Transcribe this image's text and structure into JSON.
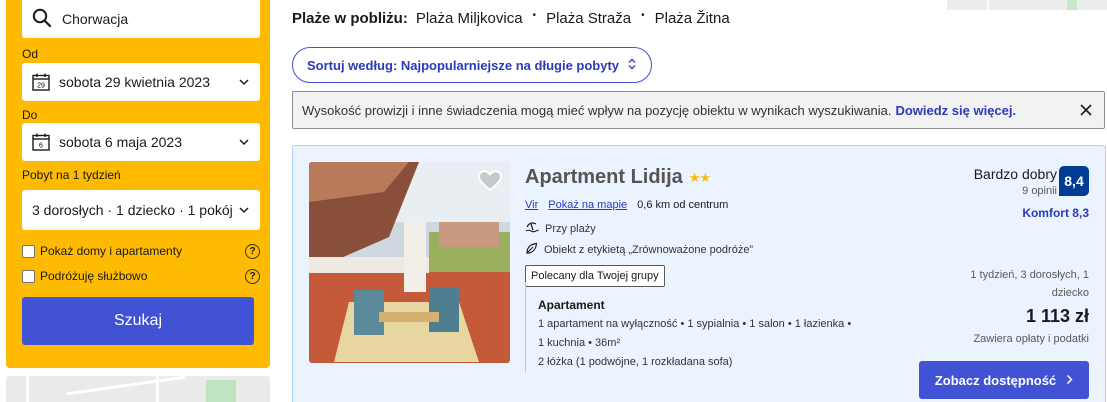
{
  "sidebar": {
    "destination": "Chorwacja",
    "checkin_label": "Od",
    "checkin_value": "sobota 29 kwietnia 2023",
    "checkin_day": "29",
    "checkout_label": "Do",
    "checkout_value": "sobota 6 maja 2023",
    "checkout_day": "6",
    "stay_label": "Pobyt na 1 tydzień",
    "guests_value": "3 dorosłych · 1 dziecko · 1 pokój",
    "checkbox_homes": "Pokaż domy i apartamenty",
    "checkbox_business": "Podróżuję służbowo",
    "search_button": "Szukaj"
  },
  "main": {
    "beaches_label": "Plaże w pobliżu:",
    "beaches": [
      "Plaża Miljkovica",
      "Plaża Straža",
      "Plaża Žitna"
    ],
    "sort_button": "Sortuj według: Najpopularniejsze na długie pobyty",
    "notice_text": "Wysokość prowizji i inne świadczenia mogą mieć wpływ na pozycję obiektu w wynikach wyszukiwania.",
    "notice_link": "Dowiedz się więcej."
  },
  "property": {
    "name": "Apartment Lidija",
    "stars": "★★",
    "town": "Vir",
    "map_link": "Pokaż na mapie",
    "distance": "0,6 km od centrum",
    "feature_beach": "Przy plaży",
    "feature_sustainable": "Obiekt z etykietą „Zrównoważone podróże”",
    "badge": "Polecany dla Twojej grupy",
    "unit_name": "Apartament",
    "unit_line1": "1 apartament na wyłączność • 1 sypialnia • 1 salon • 1 łazienka •",
    "unit_line2": "1 kuchnia • 36m²",
    "unit_beds": "2 łóżka (1 podwójne, 1 rozkładana sofa)",
    "rating_word": "Bardzo dobry",
    "reviews": "9 opinii",
    "score": "8,4",
    "comfort": "Komfort 8,3",
    "stay_info": "1 tydzień, 3 dorosłych, 1 dziecko",
    "price": "1 113 zł",
    "taxes": "Zawiera opłaty i podatki",
    "cta": "Zobacz dostępność"
  },
  "colors": {
    "accent": "#4152d5",
    "sidebar": "#febb02",
    "card": "#ebf3ff",
    "score": "#003b95"
  }
}
